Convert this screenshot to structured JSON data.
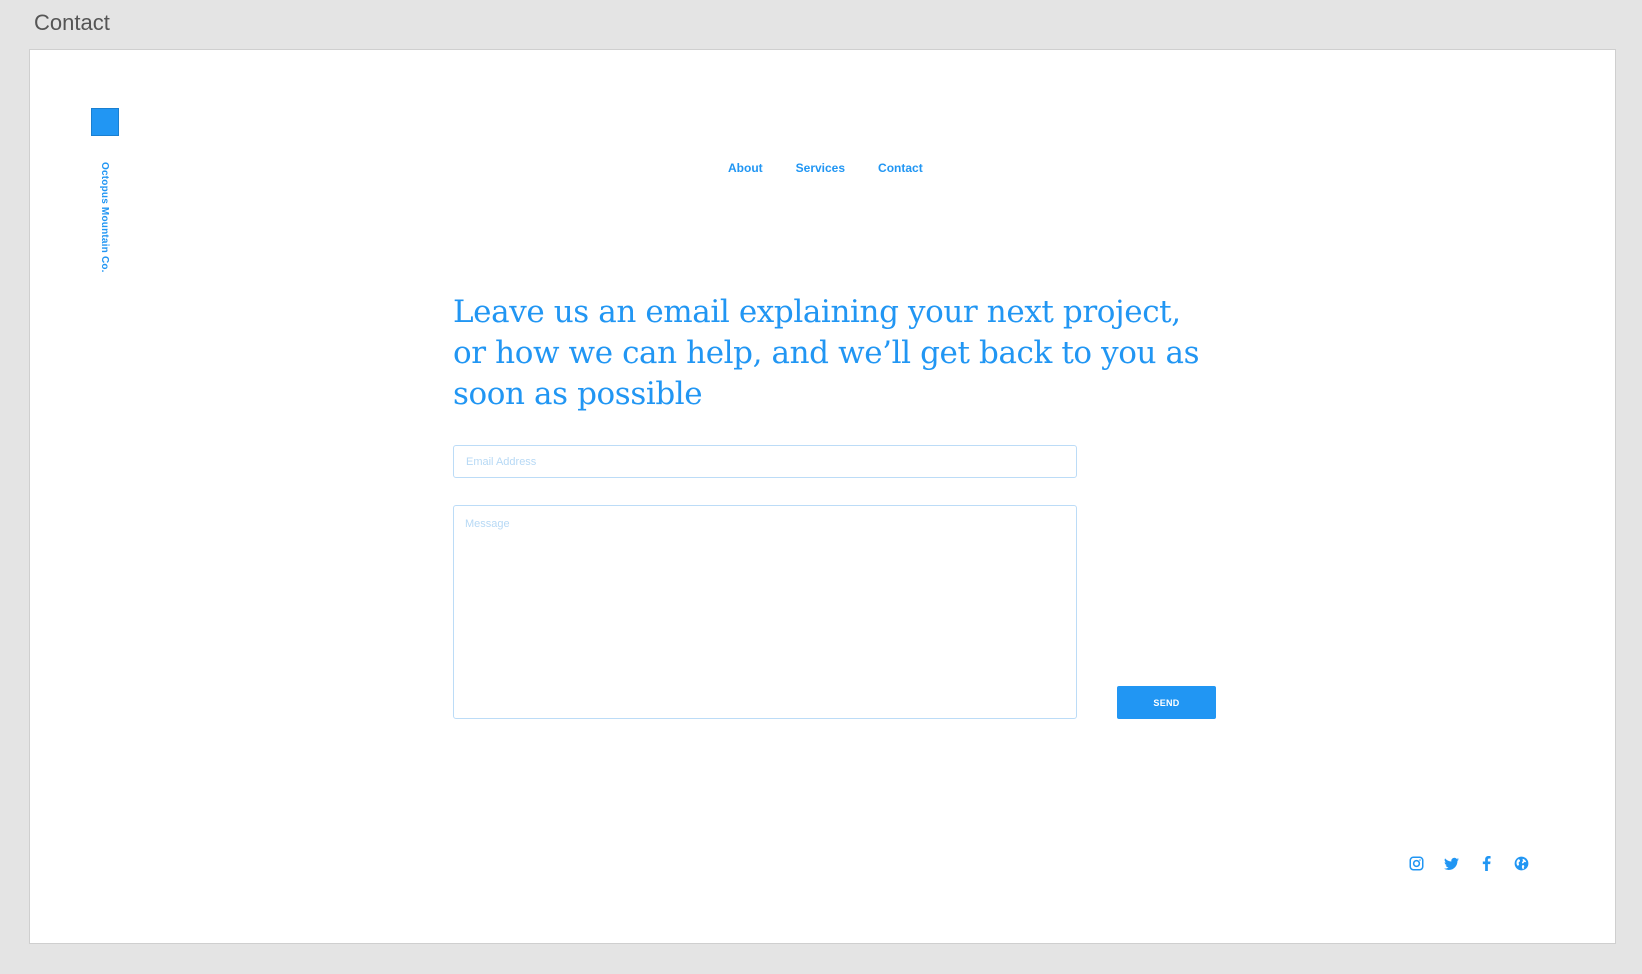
{
  "artboard": {
    "title": "Contact"
  },
  "brand": {
    "name": "Octopus Mountain Co.",
    "accent_color": "#2196f3"
  },
  "nav": {
    "items": [
      {
        "label": "About"
      },
      {
        "label": "Services"
      },
      {
        "label": "Contact"
      }
    ]
  },
  "main": {
    "headline": "Leave us an email explaining your next project, or how we can help, and we’ll get back to you as soon as possible"
  },
  "form": {
    "email": {
      "placeholder": "Email Address",
      "value": ""
    },
    "message": {
      "placeholder": "Message",
      "value": ""
    },
    "send_label": "SEND"
  },
  "social": {
    "icons": [
      "instagram-icon",
      "twitter-icon",
      "facebook-icon",
      "globe-icon"
    ]
  }
}
